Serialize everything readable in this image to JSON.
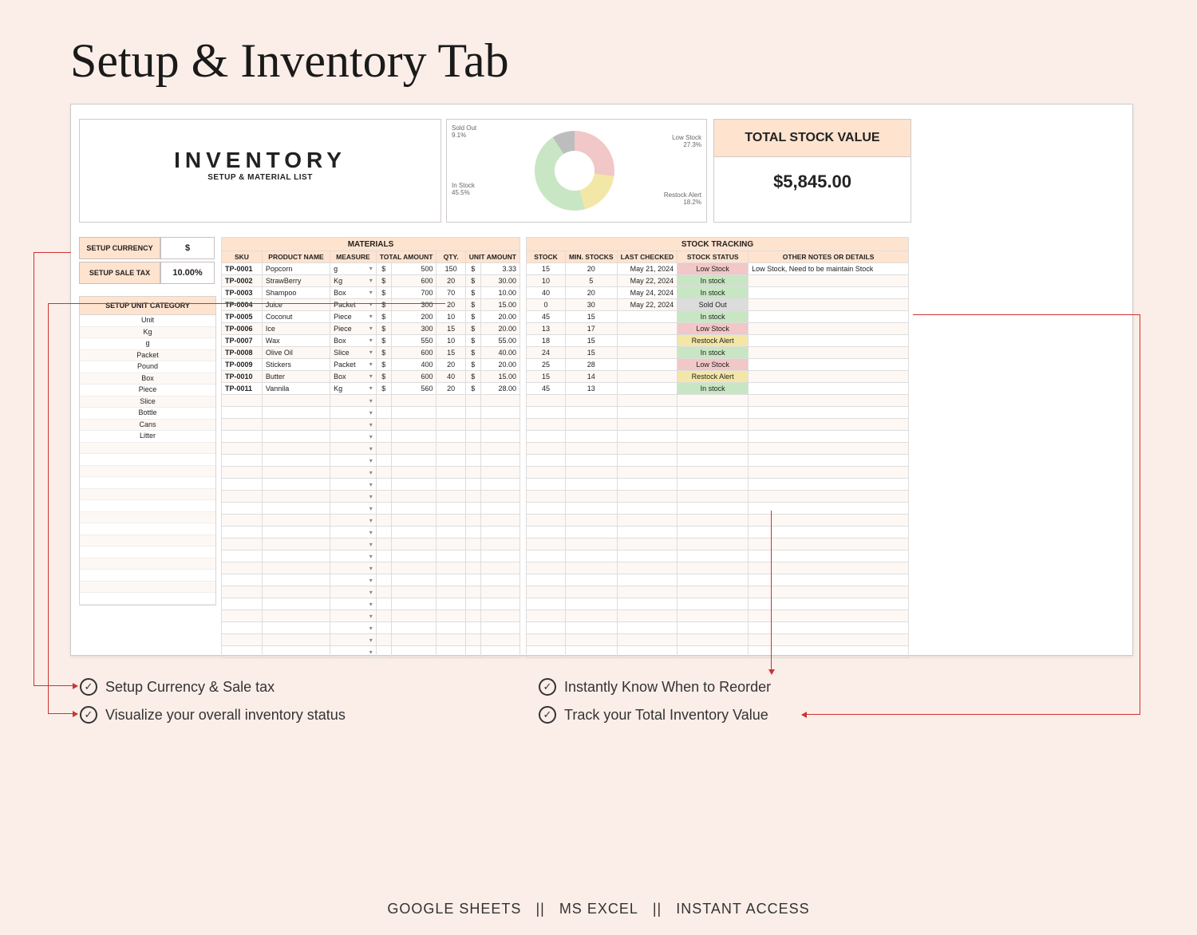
{
  "title": "Setup & Inventory Tab",
  "inventory_header": {
    "big": "INVENTORY",
    "sub": "SETUP & MATERIAL LIST"
  },
  "total_stock": {
    "label": "TOTAL STOCK VALUE",
    "value": "$5,845.00"
  },
  "setup": {
    "currency_label": "SETUP CURRENCY",
    "currency": "$",
    "tax_label": "SETUP SALE TAX",
    "tax": "10.00%"
  },
  "unit_category": {
    "header": "SETUP UNIT CATEGORY",
    "items": [
      "Unit",
      "Kg",
      "g",
      "Packet",
      "Pound",
      "Box",
      "Piece",
      "Slice",
      "Bottle",
      "Cans",
      "Litter"
    ]
  },
  "materials": {
    "section": "MATERIALS",
    "cols": [
      "SKU",
      "PRODUCT NAME",
      "MEASURE",
      "TOTAL AMOUNT",
      "QTY.",
      "UNIT AMOUNT"
    ],
    "rows": [
      {
        "sku": "TP-0001",
        "name": "Popcorn",
        "measure": "g",
        "total": "500",
        "qty": "150",
        "unit": "3.33"
      },
      {
        "sku": "TP-0002",
        "name": "StrawBerry",
        "measure": "Kg",
        "total": "600",
        "qty": "20",
        "unit": "30.00"
      },
      {
        "sku": "TP-0003",
        "name": "Shampoo",
        "measure": "Box",
        "total": "700",
        "qty": "70",
        "unit": "10.00"
      },
      {
        "sku": "TP-0004",
        "name": "Juice",
        "measure": "Packet",
        "total": "300",
        "qty": "20",
        "unit": "15.00"
      },
      {
        "sku": "TP-0005",
        "name": "Coconut",
        "measure": "Piece",
        "total": "200",
        "qty": "10",
        "unit": "20.00"
      },
      {
        "sku": "TP-0006",
        "name": "Ice",
        "measure": "Piece",
        "total": "300",
        "qty": "15",
        "unit": "20.00"
      },
      {
        "sku": "TP-0007",
        "name": "Wax",
        "measure": "Box",
        "total": "550",
        "qty": "10",
        "unit": "55.00"
      },
      {
        "sku": "TP-0008",
        "name": "Olive Oil",
        "measure": "Slice",
        "total": "600",
        "qty": "15",
        "unit": "40.00"
      },
      {
        "sku": "TP-0009",
        "name": "Stickers",
        "measure": "Packet",
        "total": "400",
        "qty": "20",
        "unit": "20.00"
      },
      {
        "sku": "TP-0010",
        "name": "Butter",
        "measure": "Box",
        "total": "600",
        "qty": "40",
        "unit": "15.00"
      },
      {
        "sku": "TP-0011",
        "name": "Vannila",
        "measure": "Kg",
        "total": "560",
        "qty": "20",
        "unit": "28.00"
      }
    ]
  },
  "tracking": {
    "section": "STOCK TRACKING",
    "cols": [
      "STOCK",
      "MIN. STOCKS",
      "LAST CHECKED",
      "STOCK STATUS",
      "OTHER NOTES OR DETAILS"
    ],
    "rows": [
      {
        "stock": "15",
        "min": "20",
        "date": "May 21, 2024",
        "status": "Low Stock",
        "cls": "st-low",
        "note": "Low Stock, Need to be maintain Stock"
      },
      {
        "stock": "10",
        "min": "5",
        "date": "May 22, 2024",
        "status": "In stock",
        "cls": "st-in",
        "note": ""
      },
      {
        "stock": "40",
        "min": "20",
        "date": "May 24, 2024",
        "status": "In stock",
        "cls": "st-in",
        "note": ""
      },
      {
        "stock": "0",
        "min": "30",
        "date": "May 22, 2024",
        "status": "Sold Out",
        "cls": "st-so",
        "note": ""
      },
      {
        "stock": "45",
        "min": "15",
        "date": "",
        "status": "In stock",
        "cls": "st-in",
        "note": ""
      },
      {
        "stock": "13",
        "min": "17",
        "date": "",
        "status": "Low Stock",
        "cls": "st-low",
        "note": ""
      },
      {
        "stock": "18",
        "min": "15",
        "date": "",
        "status": "Restock Alert",
        "cls": "st-re",
        "note": ""
      },
      {
        "stock": "24",
        "min": "15",
        "date": "",
        "status": "In stock",
        "cls": "st-in",
        "note": ""
      },
      {
        "stock": "25",
        "min": "28",
        "date": "",
        "status": "Low Stock",
        "cls": "st-low",
        "note": ""
      },
      {
        "stock": "15",
        "min": "14",
        "date": "",
        "status": "Restock Alert",
        "cls": "st-re",
        "note": ""
      },
      {
        "stock": "45",
        "min": "13",
        "date": "",
        "status": "In stock",
        "cls": "st-in",
        "note": ""
      }
    ]
  },
  "chart_data": {
    "type": "pie",
    "title": "Inventory Status",
    "categories": [
      "Low Stock",
      "Restock Alert",
      "In Stock",
      "Sold Out"
    ],
    "values": [
      27.3,
      18.2,
      45.5,
      9.1
    ],
    "labels": {
      "sold": "Sold Out",
      "sold_pct": "9.1%",
      "low": "Low Stock",
      "low_pct": "27.3%",
      "in": "In Stock",
      "in_pct": "45.5%",
      "re": "Restock Alert",
      "re_pct": "18.2%"
    }
  },
  "annotations": {
    "a1": "Setup Currency & Sale tax",
    "a2": "Visualize your overall inventory status",
    "a3": "Instantly Know When to Reorder",
    "a4": "Track your Total Inventory Value"
  },
  "footer": {
    "gs": "GOOGLE SHEETS",
    "ex": "MS EXCEL",
    "ia": "INSTANT ACCESS",
    "sep": "||"
  },
  "currency_symbol": "$",
  "empty_rows_materials": 22,
  "empty_rows_tracking": 22
}
